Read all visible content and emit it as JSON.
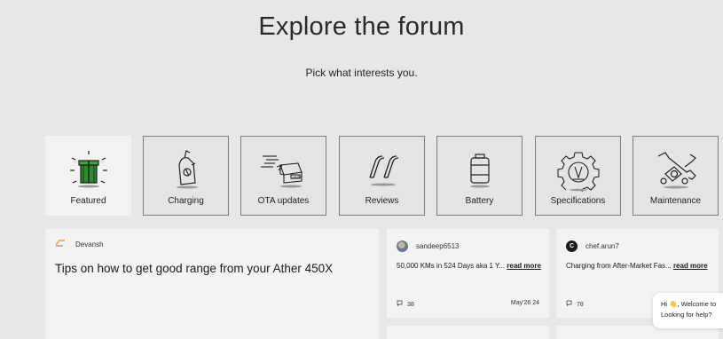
{
  "header": {
    "title": "Explore the forum",
    "subtitle": "Pick what interests you."
  },
  "categories": [
    {
      "label": "Featured",
      "icon": "gift-icon",
      "active": true
    },
    {
      "label": "Charging",
      "icon": "charger-icon",
      "active": false
    },
    {
      "label": "OTA updates",
      "icon": "update-box-icon",
      "active": false
    },
    {
      "label": "Reviews",
      "icon": "quote-icon",
      "active": false
    },
    {
      "label": "Battery",
      "icon": "battery-icon",
      "active": false
    },
    {
      "label": "Specifications",
      "icon": "gear-icon",
      "active": false
    },
    {
      "label": "Maintenance",
      "icon": "wrench-icon",
      "active": false
    }
  ],
  "featured_post": {
    "author": "Devansh",
    "title": "Tips on how to get good range from your Ather 450X"
  },
  "posts": [
    {
      "author": "sandeep6513",
      "avatar_letter": "",
      "text": "50,000 KMs in 524 Days aka 1 Y...",
      "read_more": "read more",
      "comments": "38",
      "date": "May'26 24"
    },
    {
      "author": "chef.arun7",
      "avatar_letter": "C",
      "text": "Charging from After-Market Fas...",
      "read_more": "read more",
      "comments": "78",
      "date": ""
    }
  ],
  "chat_widget": {
    "line1": "Hi 👋, Welcome to",
    "line2": "Looking for help?"
  },
  "colors": {
    "background": "#e7e7e7",
    "card": "#f3f3f3",
    "active_category": "#f2f2f2",
    "gift_green": "#2e8a2e"
  }
}
